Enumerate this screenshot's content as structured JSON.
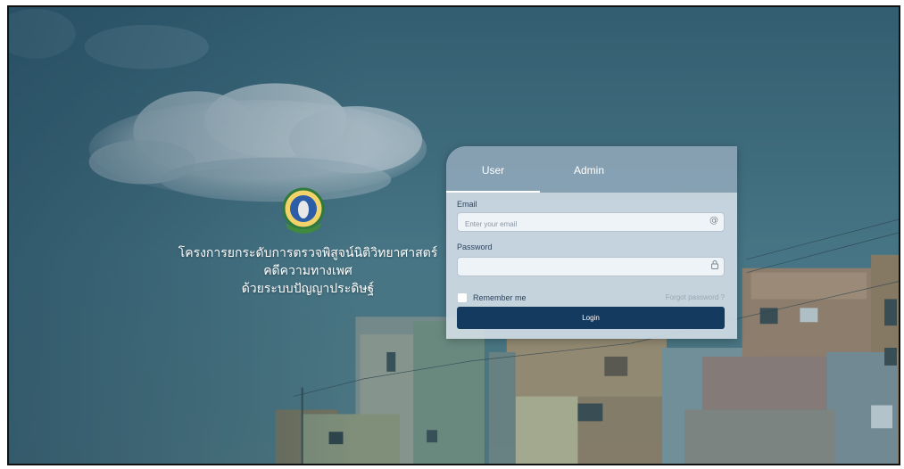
{
  "headline": {
    "line1": "โครงการยกระดับการตรวจพิสูจน์นิติวิทยาศาสตร์",
    "line2": "คดีความทางเพศ",
    "line3": "ด้วยระบบปัญญาประดิษฐ์"
  },
  "tabs": [
    {
      "label": "User",
      "active": true
    },
    {
      "label": "Admin",
      "active": false
    }
  ],
  "form": {
    "email_label": "Email",
    "email_placeholder": "Enter your email",
    "email_value": "",
    "password_label": "Password",
    "password_value": "",
    "remember_label": "Remember me",
    "forgot_label": "Forgot password ?",
    "login_label": "Login"
  },
  "icons": {
    "email": "at-icon",
    "password": "lock-icon"
  },
  "colors": {
    "login_button": "#153a60",
    "card_top": "#96acbe",
    "card_body": "#d6e0e9"
  }
}
